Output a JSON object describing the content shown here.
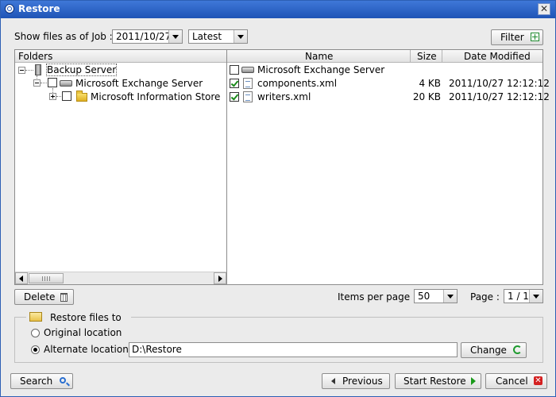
{
  "window": {
    "title": "Restore"
  },
  "job": {
    "label": "Show files as of Job :",
    "date": "2011/10/27",
    "version": "Latest",
    "filter_label": "Filter"
  },
  "folders": {
    "header": "Folders",
    "tree": [
      {
        "label": "Backup Server",
        "checked": null
      },
      {
        "label": "Microsoft Exchange Server",
        "checked": false
      },
      {
        "label": "Microsoft Information Store",
        "checked": false
      }
    ]
  },
  "files": {
    "columns": {
      "name": "Name",
      "size": "Size",
      "date": "Date Modified"
    },
    "rows": [
      {
        "name": "Microsoft Exchange Server",
        "size": "",
        "date": "",
        "checked": false
      },
      {
        "name": "components.xml",
        "size": "4 KB",
        "date": "2011/10/27 12:12:12",
        "checked": true
      },
      {
        "name": "writers.xml",
        "size": "20 KB",
        "date": "2011/10/27 12:12:12",
        "checked": true
      }
    ]
  },
  "actions": {
    "delete_label": "Delete",
    "items_per_page_label": "Items per page :",
    "items_per_page": "50",
    "page_label": "Page :",
    "page": "1 / 1"
  },
  "restore_to": {
    "legend": "Restore files to",
    "original_label": "Original location",
    "alternate_label": "Alternate location :",
    "alternate_path": "D:\\Restore",
    "change_label": "Change",
    "selected": "alternate"
  },
  "footer": {
    "search_label": "Search",
    "previous_label": "Previous",
    "start_label": "Start Restore",
    "cancel_label": "Cancel"
  },
  "colors": {
    "title_bar": "#2a63c6",
    "check_green": "#1a8a1a",
    "cancel_red": "#d42020"
  }
}
